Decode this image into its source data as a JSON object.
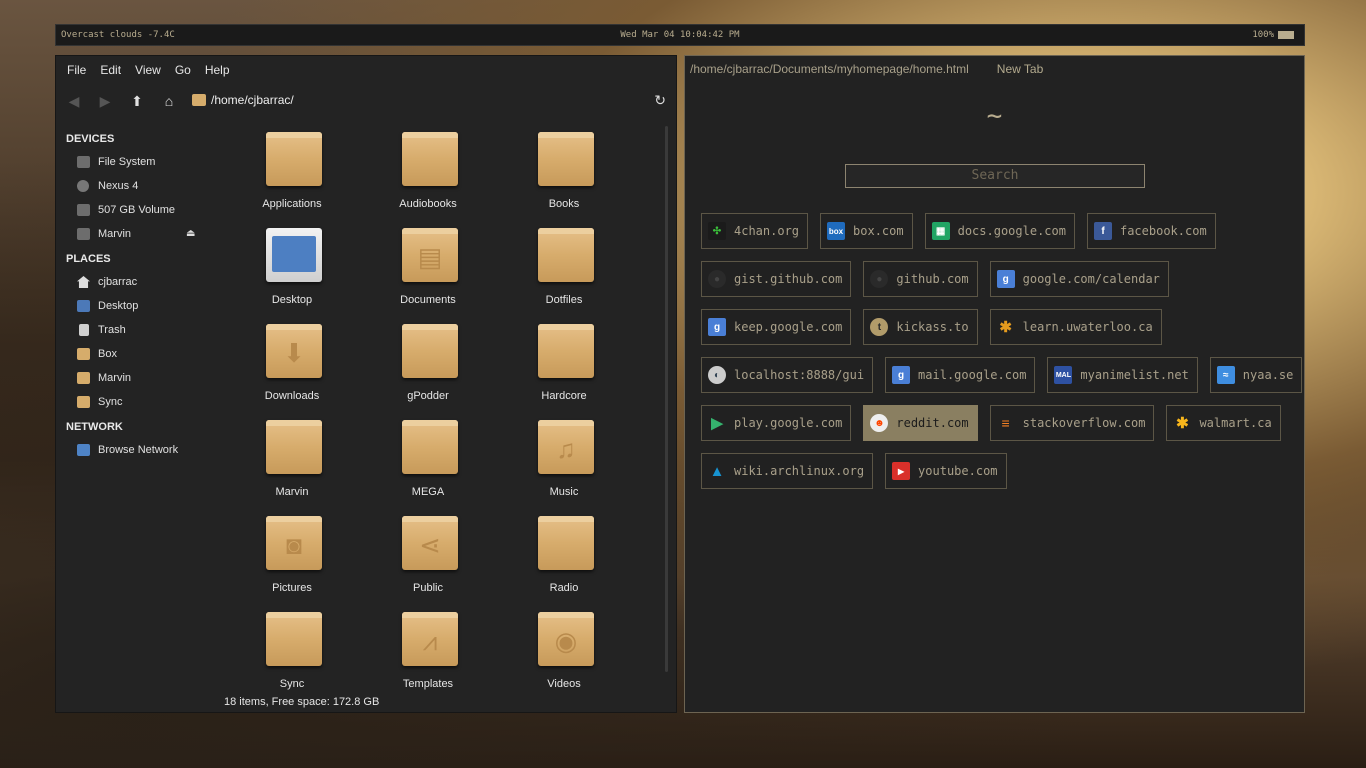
{
  "topbar": {
    "weather": "Overcast clouds -7.4C",
    "clock": "Wed Mar 04 10:04:42 PM",
    "battery": "100%"
  },
  "fm": {
    "menu": [
      "File",
      "Edit",
      "View",
      "Go",
      "Help"
    ],
    "location": "/home/cjbarrac/",
    "devices_head": "DEVICES",
    "devices": [
      "File System",
      "Nexus 4",
      "507 GB Volume",
      "Marvin"
    ],
    "places_head": "PLACES",
    "places": [
      "cjbarrac",
      "Desktop",
      "Trash",
      "Box",
      "Marvin",
      "Sync"
    ],
    "network_head": "NETWORK",
    "network": [
      "Browse Network"
    ],
    "items": [
      "Applications",
      "Audiobooks",
      "Books",
      "Desktop",
      "Documents",
      "Dotfiles",
      "Downloads",
      "gPodder",
      "Hardcore",
      "Marvin",
      "MEGA",
      "Music",
      "Pictures",
      "Public",
      "Radio",
      "Sync",
      "Templates",
      "Videos"
    ],
    "status": "18 items, Free space: 172.8 GB"
  },
  "browser": {
    "url": "/home/cjbarrac/Documents/myhomepage/home.html",
    "tab": "New Tab",
    "tilde": "~",
    "search_placeholder": "Search",
    "links": [
      [
        "4chan.org",
        "box.com",
        "docs.google.com",
        "facebook.com"
      ],
      [
        "gist.github.com",
        "github.com",
        "google.com/calendar"
      ],
      [
        "keep.google.com",
        "kickass.to",
        "learn.uwaterloo.ca"
      ],
      [
        "localhost:8888/gui",
        "mail.google.com",
        "myanimelist.net",
        "nyaa.se"
      ],
      [
        "play.google.com",
        "reddit.com",
        "stackoverflow.com",
        "walmart.ca"
      ],
      [
        "wiki.archlinux.org",
        "youtube.com"
      ]
    ],
    "active_link": "reddit.com"
  }
}
